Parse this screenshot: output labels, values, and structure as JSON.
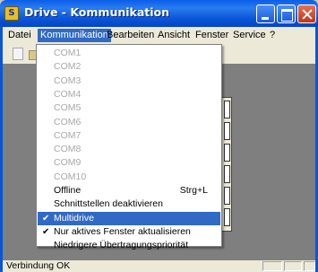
{
  "window": {
    "app_icon": "S",
    "title": "Drive - Kommunikation"
  },
  "menubar": {
    "items": [
      "Datei",
      "Kommunikation",
      "Bearbeiten",
      "Ansicht",
      "Fenster",
      "Service",
      "?"
    ]
  },
  "dropdown": {
    "com_ports": [
      "COM1",
      "COM2",
      "COM3",
      "COM4",
      "COM5",
      "COM6",
      "COM7",
      "COM8",
      "COM9",
      "COM10"
    ],
    "offline": {
      "label": "Offline",
      "shortcut": "Strg+L"
    },
    "deactivate": "Schnittstellen deaktivieren",
    "multidrive": "Multidrive",
    "active_window": "Nur aktives Fenster aktualisieren",
    "low_priority": "Niedrigere Übertragungspriorität",
    "check_glyph": "✔"
  },
  "statusbar": {
    "text": "Verbindung OK"
  }
}
